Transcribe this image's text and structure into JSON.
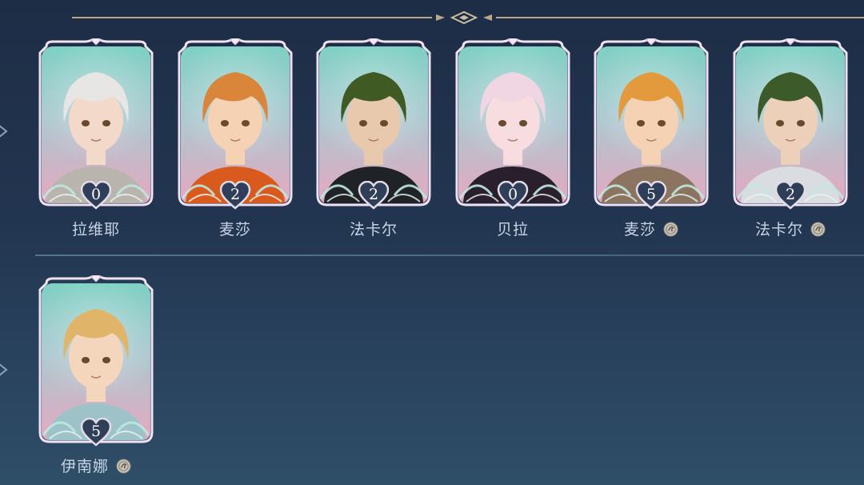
{
  "characters_row1": [
    {
      "name": "拉维耶",
      "level": "0",
      "has_coin": false,
      "hair": "#e8e6e4",
      "outfit": "#b9b4ae",
      "skin": "#f3d9c9"
    },
    {
      "name": "麦莎",
      "level": "2",
      "has_coin": false,
      "hair": "#d9863a",
      "outfit": "#d85a1c",
      "skin": "#f6d2b4"
    },
    {
      "name": "法卡尔",
      "level": "2",
      "has_coin": false,
      "hair": "#3f5a22",
      "outfit": "#1f2226",
      "skin": "#e9c9ae"
    },
    {
      "name": "贝拉",
      "level": "0",
      "has_coin": false,
      "hair": "#f0d6e2",
      "outfit": "#2a1f2c",
      "skin": "#f7dde0"
    },
    {
      "name": "麦莎",
      "level": "5",
      "has_coin": true,
      "hair": "#e39a3c",
      "outfit": "#8c7560",
      "skin": "#f6d2b4"
    },
    {
      "name": "法卡尔",
      "level": "2",
      "has_coin": true,
      "hair": "#3d5a2a",
      "outfit": "#d9dde2",
      "skin": "#ecd0ba"
    }
  ],
  "characters_row2": [
    {
      "name": "伊南娜",
      "level": "5",
      "has_coin": true,
      "hair": "#e0b56a",
      "outfit": "#9dc3c8",
      "skin": "#f4d6bc"
    }
  ],
  "colors": {
    "frame_border": "#e9dcef",
    "heart_fill": "#2f3f5a",
    "name_text": "#c7d4e4"
  }
}
